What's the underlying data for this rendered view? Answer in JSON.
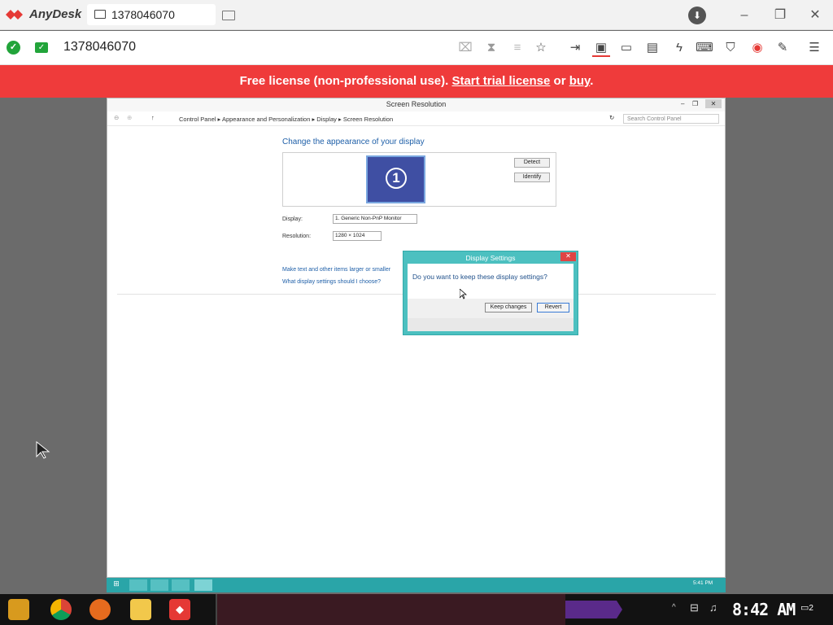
{
  "app": {
    "name": "AnyDesk",
    "tab_label": "1378046070",
    "address": "1378046070"
  },
  "license_bar": {
    "prefix": "Free license (non-professional use). ",
    "trial_link": "Start trial license",
    "middle": " or ",
    "buy_link": "buy",
    "suffix": "."
  },
  "remote": {
    "window_title": "Screen Resolution",
    "breadcrumb": "Control Panel  ▸  Appearance and Personalization  ▸  Display  ▸  Screen Resolution",
    "search_placeholder": "Search Control Panel",
    "heading": "Change the appearance of your display",
    "monitor_number": "1",
    "detect": "Detect",
    "identify": "Identify",
    "display_label": "Display:",
    "display_value": "1. Generic Non-PnP Monitor",
    "resolution_label": "Resolution:",
    "resolution_value": "1280 × 1024",
    "link1": "Make text and other items larger or smaller",
    "link2": "What display settings should I choose?",
    "clock": "5:41 PM"
  },
  "dialog": {
    "title": "Display Settings",
    "question": "Do you want to keep these display settings?",
    "keep": "Keep changes",
    "revert": "Revert"
  },
  "taskbar": {
    "clock": "8:42 AM",
    "notifications": "2"
  },
  "colors": {
    "license_bar": "#ef3b3b",
    "accent": "#22a43a",
    "remote_taskbar": "#2aa5a8"
  }
}
